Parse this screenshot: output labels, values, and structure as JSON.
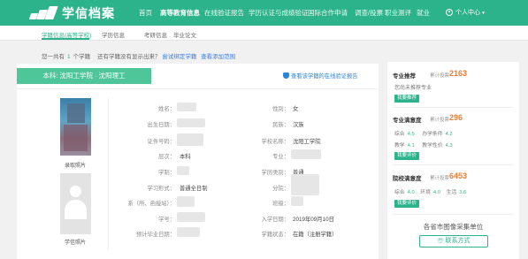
{
  "header": {
    "logo_text": "学信档案",
    "nav": [
      "首页",
      "高等教育信息",
      "在线验证报告",
      "学历认证与成绩验证",
      "国际合作申请",
      "调查/投票",
      "职业测评",
      "就业"
    ],
    "nav_active_index": 1,
    "user_menu": "个人中心"
  },
  "subnav": {
    "items": [
      "学籍信息(高等学校)",
      "学历信息",
      "考研信息",
      "毕业论文"
    ],
    "active_index": 0
  },
  "notice": {
    "prefix": "您一共有",
    "count": "1",
    "suffix": "个学籍",
    "question": "还有学籍没有显示出来？",
    "link1": "尝试绑定学籍",
    "link2": "查看添加范围"
  },
  "record": {
    "school_bar": "本科: 沈阳工学院 · 沈阳理工",
    "verify_link": "查看该学籍的在线验证报告",
    "photo_admission_label": "录取照片",
    "photo_degree_label": "学信照片",
    "fields_left": [
      {
        "label": "姓名：",
        "value": ""
      },
      {
        "label": "出生日期：",
        "value": ""
      },
      {
        "label": "证件号码：",
        "value": ""
      },
      {
        "label": "层次：",
        "value": "本科"
      },
      {
        "label": "学制：",
        "value": ""
      },
      {
        "label": "学习形式：",
        "value": "普通全日制"
      },
      {
        "label": "系（所、函授站）：",
        "value": ""
      },
      {
        "label": "学号：",
        "value": ""
      },
      {
        "label": "预计毕业日期：",
        "value": ""
      }
    ],
    "fields_right": [
      {
        "label": "性别：",
        "value": "女"
      },
      {
        "label": "民族：",
        "value": "汉族"
      },
      {
        "label": "学校名称：",
        "value": "沈阳工学院"
      },
      {
        "label": "专业：",
        "value": ""
      },
      {
        "label": "学历类别：",
        "value": "普通"
      },
      {
        "label": "分院：",
        "value": ""
      },
      {
        "label": "班级：",
        "value": ""
      },
      {
        "label": "入学日期：",
        "value": "2019年09月10日"
      },
      {
        "label": "学籍状态：",
        "value": "在籍（注册学籍）"
      }
    ]
  },
  "sidebar": {
    "major_recommend": {
      "title": "专业推荐",
      "sub": "累计投票",
      "count": "2163",
      "text": "您尚未推荐专业",
      "button": "我要推荐"
    },
    "major_satisfaction": {
      "title": "专业满意度",
      "sub": "累计投票",
      "count": "296",
      "rows": [
        {
          "a_label": "综合",
          "a_val": "4.5",
          "b_label": "办学条件",
          "b_val": "4.2"
        },
        {
          "a_label": "教学",
          "a_val": "4.1",
          "b_label": "教学性价",
          "b_val": "4.3"
        }
      ],
      "button": "我要评价"
    },
    "school_satisfaction": {
      "title": "院校满意度",
      "sub": "累计投票",
      "count": "6453",
      "row": {
        "a_label": "综合",
        "a_val": "4.0",
        "b_label": "环境",
        "b_val": "4.0",
        "c_label": "生活",
        "c_val": "3.6"
      },
      "button": "我要评价"
    },
    "collect": {
      "title": "各省市图像采集单位",
      "button": "联系方式"
    }
  },
  "colors": {
    "brand": "#2db38b",
    "accent": "#f07c2f",
    "link": "#3b7ddd"
  }
}
